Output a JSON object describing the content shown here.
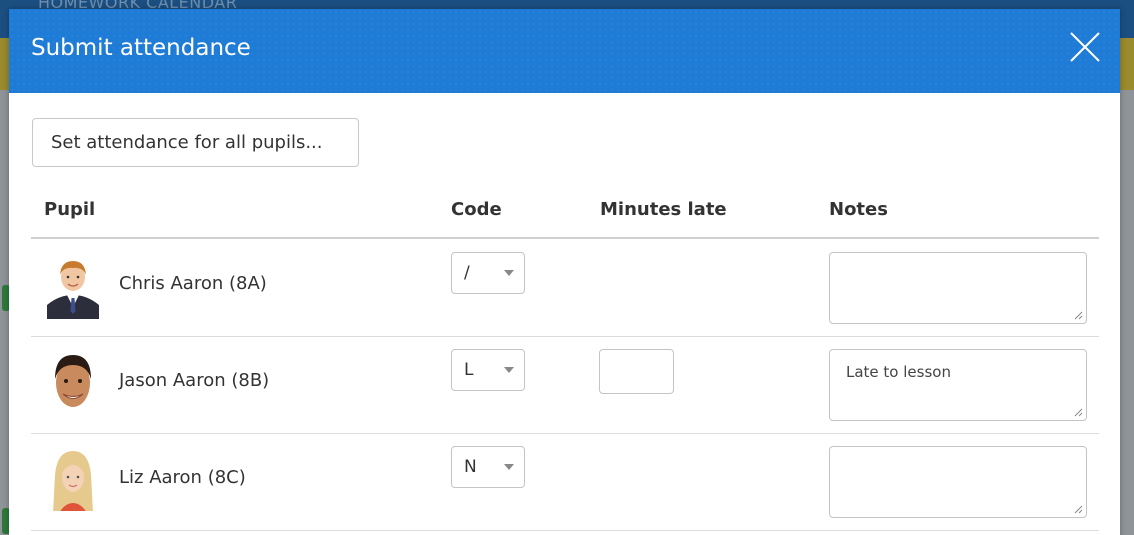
{
  "background": {
    "app_title": "HOMEWORK CALENDAR"
  },
  "dialog": {
    "title": "Submit attendance",
    "close_icon": "close-icon",
    "set_all_label": "Set attendance for all pupils..."
  },
  "table": {
    "headers": {
      "pupil": "Pupil",
      "code": "Code",
      "minutes_late": "Minutes late",
      "notes": "Notes"
    },
    "rows": [
      {
        "name": "Chris Aaron (8A)",
        "code": "/",
        "minutes_late": null,
        "notes": ""
      },
      {
        "name": "Jason Aaron (8B)",
        "code": "L",
        "minutes_late": "",
        "notes": "Late to lesson"
      },
      {
        "name": "Liz Aaron (8C)",
        "code": "N",
        "minutes_late": null,
        "notes": ""
      }
    ]
  },
  "colors": {
    "header_blue": "#1e7bd6",
    "background_navy": "#1b4f82",
    "background_gold": "#9b8a2e"
  }
}
